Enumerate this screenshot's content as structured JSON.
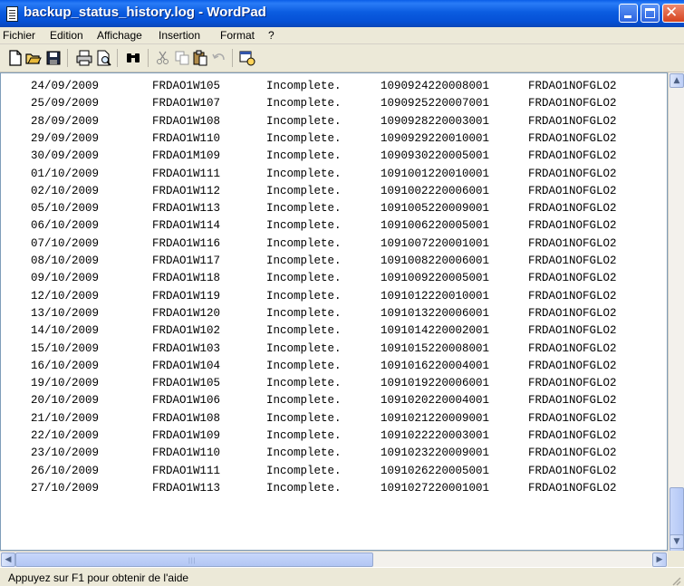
{
  "window": {
    "title": "backup_status_history.log - WordPad"
  },
  "menu": [
    "Fichier",
    "Edition",
    "Affichage",
    "Insertion",
    "Format",
    "?"
  ],
  "toolbar": {
    "icons": [
      "new-document-icon",
      "open-folder-icon",
      "save-disk-icon",
      "print-icon",
      "print-preview-icon",
      "find-binoculars-icon",
      "cut-scissors-icon",
      "copy-icon",
      "paste-icon",
      "undo-icon",
      "insert-date-time-icon"
    ]
  },
  "rows": [
    {
      "date": "24/09/2009",
      "host": "FRDAO1W105",
      "status": "Incomplete.",
      "id": "1090924220008001",
      "code": "FRDAO1NOFGLO2"
    },
    {
      "date": "25/09/2009",
      "host": "FRDAO1W107",
      "status": "Incomplete.",
      "id": "1090925220007001",
      "code": "FRDAO1NOFGLO2"
    },
    {
      "date": "28/09/2009",
      "host": "FRDAO1W108",
      "status": "Incomplete.",
      "id": "1090928220003001",
      "code": "FRDAO1NOFGLO2"
    },
    {
      "date": "29/09/2009",
      "host": "FRDAO1W110",
      "status": "Incomplete.",
      "id": "1090929220010001",
      "code": "FRDAO1NOFGLO2"
    },
    {
      "date": "30/09/2009",
      "host": "FRDAO1M109",
      "status": "Incomplete.",
      "id": "1090930220005001",
      "code": "FRDAO1NOFGLO2"
    },
    {
      "date": "01/10/2009",
      "host": "FRDAO1W111",
      "status": "Incomplete.",
      "id": "1091001220010001",
      "code": "FRDAO1NOFGLO2"
    },
    {
      "date": "02/10/2009",
      "host": "FRDAO1W112",
      "status": "Incomplete.",
      "id": "1091002220006001",
      "code": "FRDAO1NOFGLO2"
    },
    {
      "date": "05/10/2009",
      "host": "FRDAO1W113",
      "status": "Incomplete.",
      "id": "1091005220009001",
      "code": "FRDAO1NOFGLO2"
    },
    {
      "date": "06/10/2009",
      "host": "FRDAO1W114",
      "status": "Incomplete.",
      "id": "1091006220005001",
      "code": "FRDAO1NOFGLO2"
    },
    {
      "date": "07/10/2009",
      "host": "FRDAO1W116",
      "status": "Incomplete.",
      "id": "1091007220001001",
      "code": "FRDAO1NOFGLO2"
    },
    {
      "date": "08/10/2009",
      "host": "FRDAO1W117",
      "status": "Incomplete.",
      "id": "1091008220006001",
      "code": "FRDAO1NOFGLO2"
    },
    {
      "date": "09/10/2009",
      "host": "FRDAO1W118",
      "status": "Incomplete.",
      "id": "1091009220005001",
      "code": "FRDAO1NOFGLO2"
    },
    {
      "date": "12/10/2009",
      "host": "FRDAO1W119",
      "status": "Incomplete.",
      "id": "1091012220010001",
      "code": "FRDAO1NOFGLO2"
    },
    {
      "date": "13/10/2009",
      "host": "FRDAO1W120",
      "status": "Incomplete.",
      "id": "1091013220006001",
      "code": "FRDAO1NOFGLO2"
    },
    {
      "date": "14/10/2009",
      "host": "FRDAO1W102",
      "status": "Incomplete.",
      "id": "1091014220002001",
      "code": "FRDAO1NOFGLO2"
    },
    {
      "date": "15/10/2009",
      "host": "FRDAO1W103",
      "status": "Incomplete.",
      "id": "1091015220008001",
      "code": "FRDAO1NOFGLO2"
    },
    {
      "date": "16/10/2009",
      "host": "FRDAO1W104",
      "status": "Incomplete.",
      "id": "1091016220004001",
      "code": "FRDAO1NOFGLO2"
    },
    {
      "date": "19/10/2009",
      "host": "FRDAO1W105",
      "status": "Incomplete.",
      "id": "1091019220006001",
      "code": "FRDAO1NOFGLO2"
    },
    {
      "date": "20/10/2009",
      "host": "FRDAO1W106",
      "status": "Incomplete.",
      "id": "1091020220004001",
      "code": "FRDAO1NOFGLO2"
    },
    {
      "date": "21/10/2009",
      "host": "FRDAO1W108",
      "status": "Incomplete.",
      "id": "1091021220009001",
      "code": "FRDAO1NOFGLO2"
    },
    {
      "date": "22/10/2009",
      "host": "FRDAO1W109",
      "status": "Incomplete.",
      "id": "1091022220003001",
      "code": "FRDAO1NOFGLO2"
    },
    {
      "date": "23/10/2009",
      "host": "FRDAO1W110",
      "status": "Incomplete.",
      "id": "1091023220009001",
      "code": "FRDAO1NOFGLO2"
    },
    {
      "date": "26/10/2009",
      "host": "FRDAO1W111",
      "status": "Incomplete.",
      "id": "1091026220005001",
      "code": "FRDAO1NOFGLO2"
    },
    {
      "date": "27/10/2009",
      "host": "FRDAO1W113",
      "status": "Incomplete.",
      "id": "1091027220001001",
      "code": "FRDAO1NOFGLO2"
    }
  ],
  "scrollbars": {
    "vertical": {
      "up": "▲",
      "down": "▼",
      "position": 0.85
    },
    "horizontal": {
      "left": "◀",
      "right": "▶",
      "grip": "|||"
    }
  },
  "status": {
    "text": "Appuyez sur F1 pour obtenir de l'aide"
  },
  "colors": {
    "titlebar": "#0550d6",
    "close_button": "#d6431f",
    "window_bg": "#ece9d8",
    "editor_bg": "#ffffff"
  }
}
